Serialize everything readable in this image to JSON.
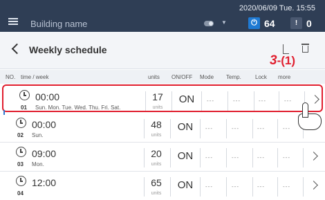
{
  "topbar": {
    "building_name": "Building name",
    "datetime": "2020/06/09 Tue. 15:55",
    "power_count": "64",
    "alarm_count": "0",
    "alarm_glyph": "!",
    "power_glyph": "⏻",
    "dropdown_glyph": "▼",
    "icons": [
      "menu-icon",
      "toggle-icon",
      "chevron-down-icon",
      "power-icon",
      "alarm-icon"
    ]
  },
  "titlebar": {
    "title": "Weekly schedule",
    "icons": [
      "back-icon",
      "edit-icon",
      "delete-icon"
    ]
  },
  "annotation": {
    "step": "3",
    "sep": "-(",
    "sub": "1",
    "close": ")"
  },
  "columns": {
    "no": "NO.",
    "time_week": "time / week",
    "units": "units",
    "onoff": "ON/OFF",
    "mode": "Mode",
    "temp": "Temp.",
    "lock": "Lock",
    "more": "more"
  },
  "rows": [
    {
      "no": "01",
      "time": "00:00",
      "days": "Sun. Mon. Tue. Wed. Thu. Fri. Sat.",
      "units": "17",
      "units_label": "units",
      "onoff": "ON",
      "mode": "---",
      "temp": "---",
      "lock": "---",
      "more": "---",
      "selected": true
    },
    {
      "no": "02",
      "time": "00:00",
      "days": "Sun.",
      "units": "48",
      "units_label": "units",
      "onoff": "ON",
      "mode": "---",
      "temp": "---",
      "lock": "---",
      "more": "---",
      "selected": false
    },
    {
      "no": "03",
      "time": "09:00",
      "days": "Mon.",
      "units": "20",
      "units_label": "units",
      "onoff": "ON",
      "mode": "---",
      "temp": "---",
      "lock": "---",
      "more": "---",
      "selected": false
    },
    {
      "no": "04",
      "time": "12:00",
      "days": "",
      "units": "65",
      "units_label": "units",
      "onoff": "ON",
      "mode": "---",
      "temp": "---",
      "lock": "---",
      "more": "---",
      "selected": false
    }
  ],
  "colors": {
    "topbar_bg": "#2f3e55",
    "accent_red": "#e01e2e",
    "power_blue": "#1f7ad3"
  }
}
